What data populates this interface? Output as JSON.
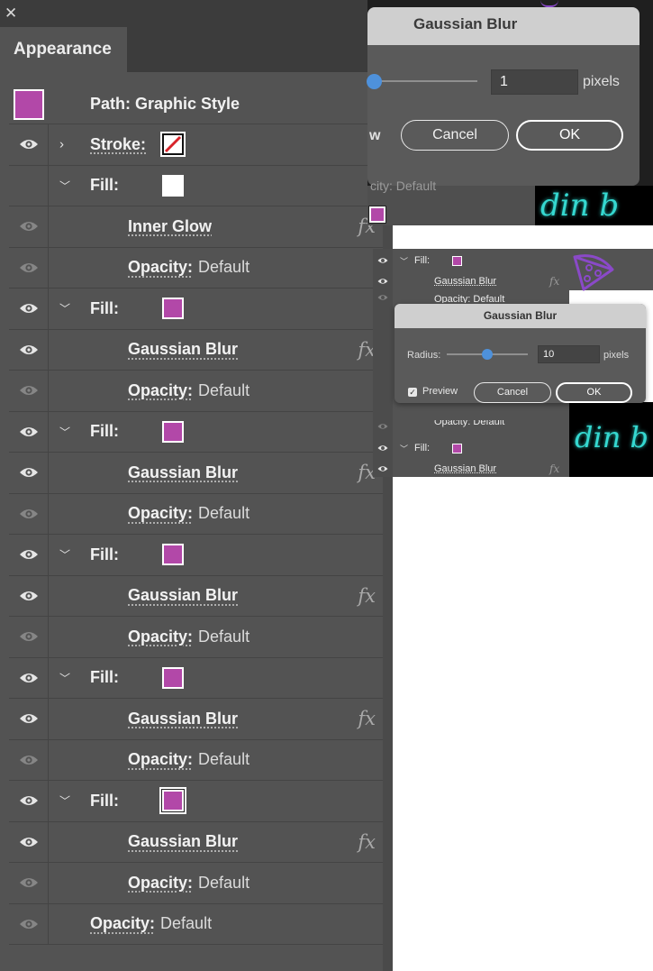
{
  "panel": {
    "close_glyph": "✕",
    "tab_label": "Appearance",
    "header_label": "Path: Graphic Style",
    "colors": {
      "purple": "#b248a8",
      "panel_bg": "#535353",
      "accent": "#4e91db"
    },
    "rows": {
      "stroke": {
        "label": "Stroke:"
      },
      "fill0": {
        "label": "Fill:"
      },
      "inner_glow": {
        "label": "Inner Glow"
      },
      "opacity0": {
        "label": "Opacity:",
        "value": "Default"
      },
      "fill1": {
        "label": "Fill:"
      },
      "blur1": {
        "label": "Gaussian Blur"
      },
      "opacity1": {
        "label": "Opacity:",
        "value": "Default"
      },
      "fill2": {
        "label": "Fill:"
      },
      "blur2": {
        "label": "Gaussian Blur"
      },
      "opacity2": {
        "label": "Opacity:",
        "value": "Default"
      },
      "fill3": {
        "label": "Fill:"
      },
      "blur3": {
        "label": "Gaussian Blur"
      },
      "opacity3": {
        "label": "Opacity:",
        "value": "Default"
      },
      "fill4": {
        "label": "Fill:"
      },
      "blur4": {
        "label": "Gaussian Blur"
      },
      "opacity4": {
        "label": "Opacity:",
        "value": "Default"
      },
      "fill5": {
        "label": "Fill:"
      },
      "blur5": {
        "label": "Gaussian Blur"
      },
      "opacity5": {
        "label": "Opacity:",
        "value": "Default"
      },
      "opacity_final": {
        "label": "Opacity:",
        "value": "Default"
      }
    },
    "fx_glyph": "fx"
  },
  "dialog_large": {
    "title": "Gaussian Blur",
    "radius_value": "1",
    "unit": "pixels",
    "preview_fragment": "w",
    "cancel_label": "Cancel",
    "ok_label": "OK",
    "under_text": "city: Default",
    "neon_text": "din b"
  },
  "panel_small": {
    "rows": [
      {
        "kind": "fill",
        "label": "Fill:"
      },
      {
        "kind": "effect",
        "label": "Gaussian Blur"
      },
      {
        "kind": "opacity",
        "label": "Opacity: Default"
      }
    ],
    "bottom_rows": [
      {
        "kind": "opacity",
        "label": "Opacity: Default"
      },
      {
        "kind": "fill",
        "label": "Fill:"
      },
      {
        "kind": "effect",
        "label": "Gaussian Blur"
      }
    ],
    "neon_text": "din b"
  },
  "dialog_small": {
    "title": "Gaussian Blur",
    "radius_label": "Radius:",
    "radius_value": "10",
    "unit": "pixels",
    "preview_label": "Preview",
    "check_glyph": "✓",
    "cancel_label": "Cancel",
    "ok_label": "OK"
  }
}
